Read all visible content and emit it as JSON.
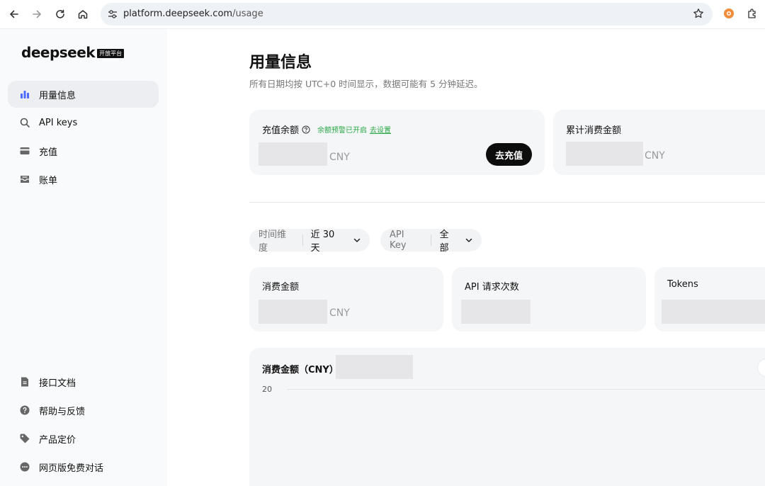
{
  "browser": {
    "url_host": "platform.deepseek.com",
    "url_path": "/usage"
  },
  "sidebar": {
    "logo_text": "deepseek",
    "logo_badge": "开放平台",
    "top_items": [
      {
        "label": "用量信息",
        "icon": "bar-chart-icon",
        "active": true
      },
      {
        "label": "API keys",
        "icon": "search-icon"
      },
      {
        "label": "充值",
        "icon": "card-icon"
      },
      {
        "label": "账单",
        "icon": "inbox-icon"
      }
    ],
    "bottom_items": [
      {
        "label": "接口文档",
        "icon": "document-icon"
      },
      {
        "label": "帮助与反馈",
        "icon": "help-icon"
      },
      {
        "label": "产品定价",
        "icon": "price-tag-icon"
      },
      {
        "label": "网页版免费对话",
        "icon": "chat-bubble-icon"
      }
    ]
  },
  "page": {
    "title": "用量信息",
    "note": "所有日期均按 UTC+0 时间显示，数据可能有 5 分钟延迟。"
  },
  "balance_card": {
    "label": "充值余额",
    "warning_text": "余额预警已开启",
    "warning_link": "去设置",
    "currency": "CNY",
    "button": "去充值"
  },
  "total_spend_card": {
    "label": "累计消费金额",
    "currency": "CNY"
  },
  "filters": [
    {
      "key": "时间维度",
      "value": "近 30 天"
    },
    {
      "key": "API Key",
      "value": "全部"
    }
  ],
  "stats": [
    {
      "label": "消费金额",
      "currency": "CNY"
    },
    {
      "label": "API 请求次数",
      "currency": ""
    },
    {
      "label": "Tokens",
      "currency": ""
    }
  ],
  "chart": {
    "title": "消费金额（CNY）",
    "ytick": "20"
  },
  "colors": {
    "accent_blue": "#4d6bfe",
    "warning_green": "#28a745"
  }
}
